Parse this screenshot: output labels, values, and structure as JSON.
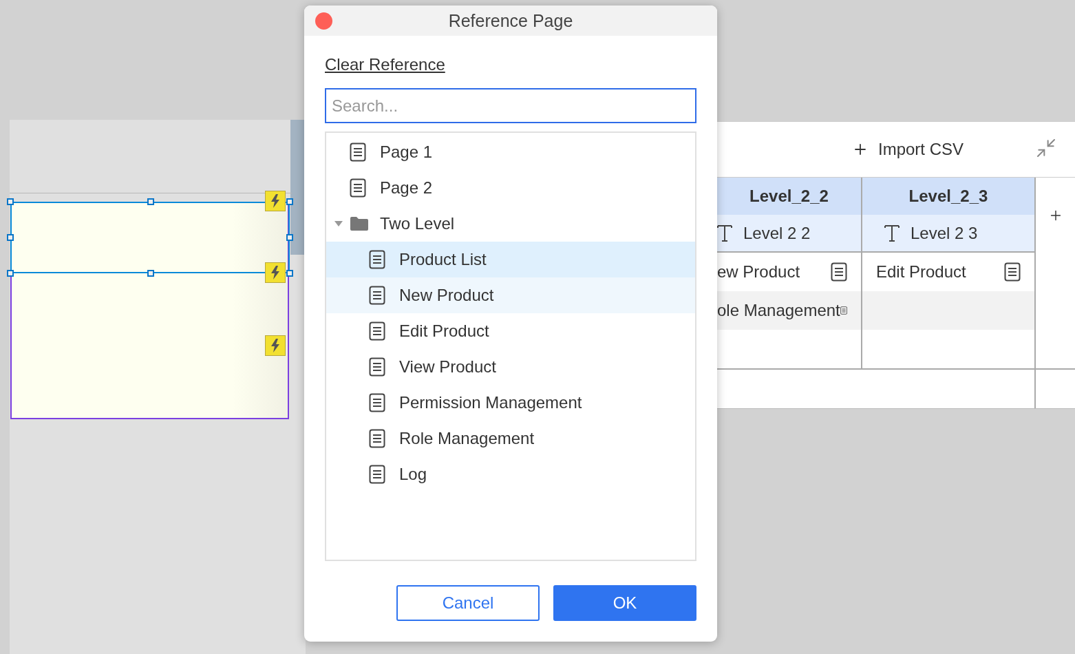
{
  "canvas": {
    "widgets": [
      {
        "kind": "panel",
        "selected": true
      }
    ],
    "event_badges": [
      {
        "kind": "event"
      },
      {
        "kind": "event"
      },
      {
        "kind": "event"
      }
    ]
  },
  "table_panel": {
    "import_label": "Import CSV",
    "columns": [
      {
        "label": "Level_2_2",
        "field": "Level 2 2"
      },
      {
        "label": "Level_2_3",
        "field": "Level 2 3"
      }
    ],
    "rows": [
      {
        "shaded": false,
        "cells": [
          {
            "text": "ew Product"
          },
          {
            "text": "Edit Product"
          }
        ]
      },
      {
        "shaded": true,
        "cells": [
          {
            "text": "ole Management"
          },
          null
        ]
      },
      {
        "shaded": false,
        "cells": [
          null,
          null
        ]
      }
    ]
  },
  "dialog": {
    "title": "Reference Page",
    "clear_link": "Clear Reference",
    "search": {
      "placeholder": "Search..."
    },
    "tree": [
      {
        "kind": "page",
        "label": "Page 1",
        "selected": false,
        "hovered": false
      },
      {
        "kind": "page",
        "label": "Page 2",
        "selected": false,
        "hovered": false
      },
      {
        "kind": "folder",
        "label": "Two Level",
        "selected": false,
        "hovered": false,
        "expanded": true,
        "children": [
          {
            "kind": "page",
            "label": "Product List",
            "selected": true,
            "hovered": false
          },
          {
            "kind": "page",
            "label": "New Product",
            "selected": false,
            "hovered": true
          },
          {
            "kind": "page",
            "label": "Edit Product",
            "selected": false,
            "hovered": false
          },
          {
            "kind": "page",
            "label": "View Product",
            "selected": false,
            "hovered": false
          },
          {
            "kind": "page",
            "label": "Permission Management",
            "selected": false,
            "hovered": false
          },
          {
            "kind": "page",
            "label": "Role Management",
            "selected": false,
            "hovered": false
          },
          {
            "kind": "page",
            "label": "Log",
            "selected": false,
            "hovered": false
          }
        ]
      }
    ],
    "buttons": [
      {
        "kind": "secondary",
        "label": "Cancel"
      },
      {
        "kind": "primary",
        "label": "OK"
      }
    ]
  }
}
